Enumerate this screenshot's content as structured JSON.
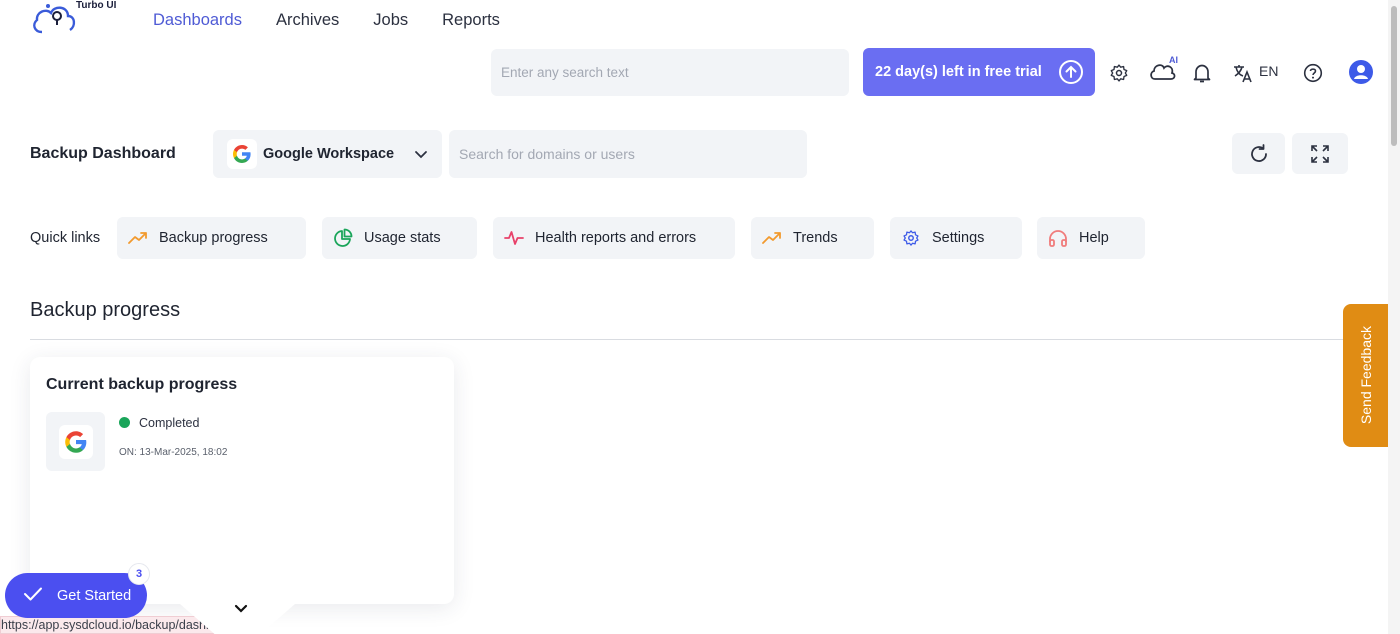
{
  "brand": {
    "name": "Turbo UI"
  },
  "nav": {
    "items": [
      {
        "label": "Dashboards",
        "active": true
      },
      {
        "label": "Archives",
        "active": false
      },
      {
        "label": "Jobs",
        "active": false
      },
      {
        "label": "Reports",
        "active": false
      }
    ]
  },
  "topbar": {
    "search_placeholder": "Enter any search text",
    "trial_label": "22 day(s) left in free trial",
    "ai_badge": "AI",
    "language": "EN"
  },
  "dashboard": {
    "title": "Backup Dashboard",
    "platform": "Google Workspace",
    "domain_search_placeholder": "Search for domains or users"
  },
  "quick_links": {
    "label": "Quick links",
    "items": [
      {
        "label": "Backup progress",
        "icon": "trending-up-icon"
      },
      {
        "label": "Usage stats",
        "icon": "pie-chart-icon"
      },
      {
        "label": "Health reports and errors",
        "icon": "pulse-icon"
      },
      {
        "label": "Trends",
        "icon": "trending-up-icon"
      },
      {
        "label": "Settings",
        "icon": "gear-icon"
      },
      {
        "label": "Help",
        "icon": "headphones-icon"
      }
    ]
  },
  "section": {
    "title": "Backup progress"
  },
  "card": {
    "title": "Current backup progress",
    "status": "Completed",
    "status_color": "#1aa55a",
    "date": "ON: 13-Mar-2025, 18:02"
  },
  "feedback": {
    "label": "Send Feedback"
  },
  "get_started": {
    "label": "Get Started",
    "badge": "3"
  },
  "status_bar": {
    "url": "https://app.sysdcloud.io/backup/dashboard"
  },
  "colors": {
    "accent": "#4f5bd5",
    "trial": "#6a6ef2",
    "feedback": "#e08c14",
    "get_started": "#4b4ff0"
  }
}
